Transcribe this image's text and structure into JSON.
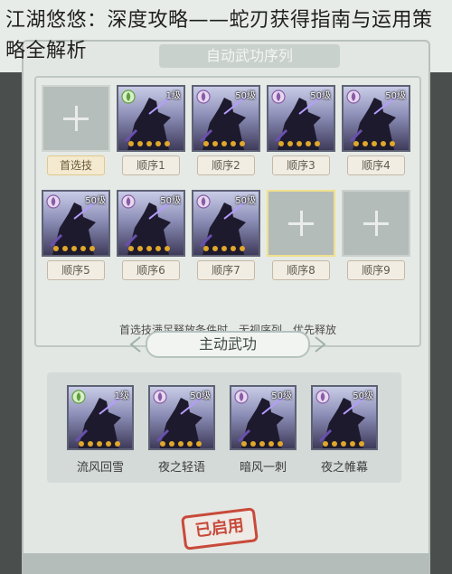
{
  "article_title": "江湖悠悠：深度攻略——蛇刃获得指南与运用策略全解析",
  "panel": {
    "header": "自动武功序列",
    "first_slot_label": "首选技",
    "order_slots": [
      {
        "label": "顺序1",
        "level": "1级",
        "emblem": "green-leaf-emblem",
        "filled": true
      },
      {
        "label": "顺序2",
        "level": "50级",
        "emblem": "purple-rose-emblem",
        "filled": true
      },
      {
        "label": "顺序3",
        "level": "50级",
        "emblem": "purple-rose-emblem",
        "filled": true
      },
      {
        "label": "顺序4",
        "level": "50级",
        "emblem": "purple-rose-emblem",
        "filled": true
      },
      {
        "label": "顺序5",
        "level": "50级",
        "emblem": "purple-rose-emblem",
        "filled": true
      },
      {
        "label": "顺序6",
        "level": "50级",
        "emblem": "purple-rose-emblem",
        "filled": true
      },
      {
        "label": "顺序7",
        "level": "50级",
        "emblem": "purple-rose-emblem",
        "filled": true
      },
      {
        "label": "顺序8",
        "filled": false,
        "selected": true
      },
      {
        "label": "顺序9",
        "filled": false
      }
    ],
    "hint": "首选技满足释放条件时，无视序列，优先释放",
    "section_title": "主动武功",
    "active_skills": [
      {
        "name": "流风回雪",
        "level": "1级",
        "emblem": "green-leaf-emblem"
      },
      {
        "name": "夜之轻语",
        "level": "50级",
        "emblem": "purple-rose-emblem"
      },
      {
        "name": "暗风一刺",
        "level": "50级",
        "emblem": "purple-rose-emblem"
      },
      {
        "name": "夜之帷幕",
        "level": "50级",
        "emblem": "purple-rose-emblem"
      }
    ],
    "status_stamp": "已启用"
  },
  "colors": {
    "panel_bg": "#e3e7e3",
    "skill_frame": "#5e6275",
    "stamp_red": "#c84a3a",
    "selected_gold": "#f0e08c"
  }
}
